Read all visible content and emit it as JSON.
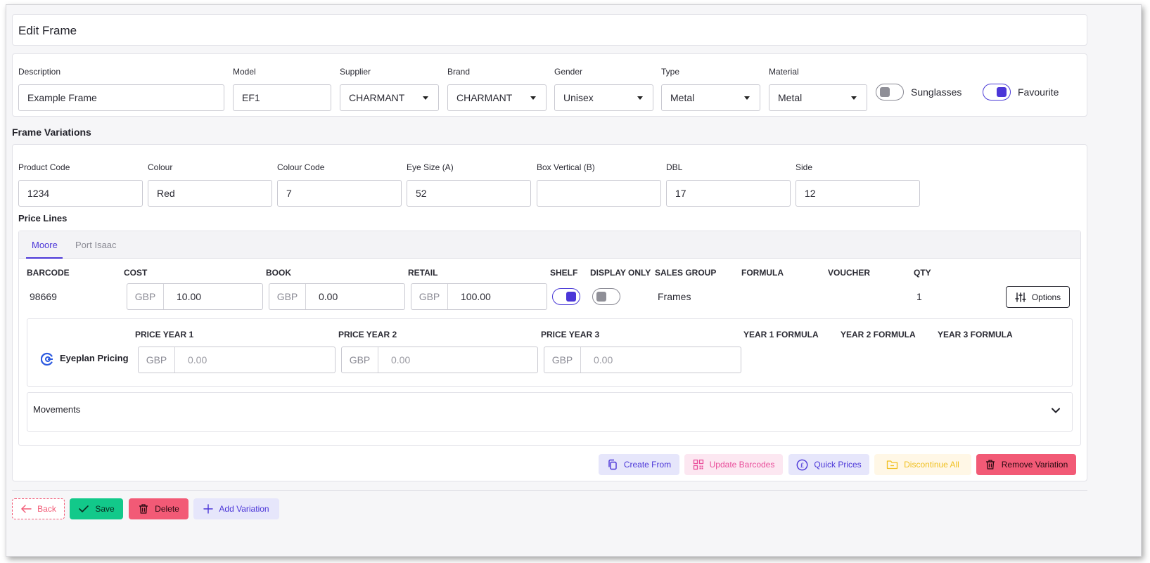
{
  "header": {
    "title": "Edit Frame"
  },
  "frame_details": {
    "description": {
      "label": "Description",
      "value": "Example Frame"
    },
    "model": {
      "label": "Model",
      "value": "EF1"
    },
    "supplier": {
      "label": "Supplier",
      "value": "CHARMANT"
    },
    "brand": {
      "label": "Brand",
      "value": "CHARMANT"
    },
    "gender": {
      "label": "Gender",
      "value": "Unisex"
    },
    "type": {
      "label": "Type",
      "value": "Metal"
    },
    "material": {
      "label": "Material",
      "value": "Metal"
    },
    "sunglasses": {
      "label": "Sunglasses",
      "on": false
    },
    "favourite": {
      "label": "Favourite",
      "on": true
    }
  },
  "variations": {
    "title": "Frame Variations",
    "product_code": {
      "label": "Product Code",
      "value": "1234"
    },
    "colour": {
      "label": "Colour",
      "value": "Red"
    },
    "colour_code": {
      "label": "Colour Code",
      "value": "7"
    },
    "eye_size": {
      "label": "Eye Size (A)",
      "value": "52"
    },
    "box_vertical": {
      "label": "Box Vertical (B)",
      "value": ""
    },
    "dbl": {
      "label": "DBL",
      "value": "17"
    },
    "side": {
      "label": "Side",
      "value": "12"
    }
  },
  "price_lines": {
    "title": "Price Lines",
    "tabs": [
      {
        "label": "Moore",
        "active": true
      },
      {
        "label": "Port Isaac",
        "active": false
      }
    ],
    "headers": {
      "barcode": "BARCODE",
      "cost": "COST",
      "book": "BOOK",
      "retail": "RETAIL",
      "shelf": "SHELF",
      "display_only": "DISPLAY ONLY",
      "sales_group": "SALES GROUP",
      "formula": "FORMULA",
      "voucher": "VOUCHER",
      "qty": "QTY"
    },
    "row": {
      "barcode": "98669",
      "currency": "GBP",
      "cost": "10.00",
      "book": "0.00",
      "retail": "100.00",
      "shelf": true,
      "display_only": false,
      "sales_group": "Frames",
      "qty": "1",
      "options_label": "Options"
    },
    "eyeplan": {
      "label": "Eyeplan Pricing",
      "headers": {
        "price_year_1": "PRICE YEAR 1",
        "price_year_2": "PRICE YEAR 2",
        "price_year_3": "PRICE YEAR 3",
        "year1_formula": "YEAR 1 FORMULA",
        "year2_formula": "YEAR 2 FORMULA",
        "year3_formula": "YEAR 3 FORMULA"
      },
      "currency": "GBP",
      "price_year_1_placeholder": "0.00",
      "price_year_2_placeholder": "0.00",
      "price_year_3_placeholder": "0.00"
    },
    "movements": {
      "label": "Movements"
    }
  },
  "variation_actions": {
    "create_from": "Create From",
    "update_barcodes": "Update Barcodes",
    "quick_prices": "Quick Prices",
    "discontinue_all": "Discontinue All",
    "remove_variation": "Remove Variation"
  },
  "footer": {
    "back": "Back",
    "save": "Save",
    "delete": "Delete",
    "add_variation": "Add Variation"
  },
  "colors": {
    "accent": "#4b36d8",
    "danger": "#f25a76",
    "success": "#12c98a",
    "warning": "#f4c430",
    "pink": "#e94d9a"
  }
}
